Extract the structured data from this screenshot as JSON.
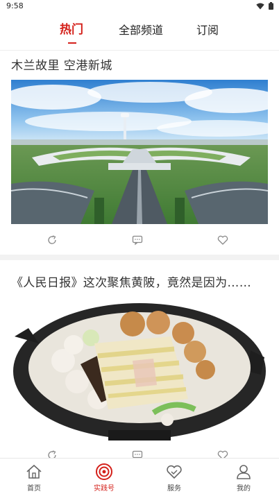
{
  "status_bar": {
    "time": "9:58"
  },
  "tabs": [
    {
      "label": "热门",
      "active": true
    },
    {
      "label": "全部频道",
      "active": false
    },
    {
      "label": "订阅",
      "active": false
    }
  ],
  "articles": [
    {
      "title": "木兰故里 空港新城",
      "image_alt": "airport aerial view"
    },
    {
      "title": "《人民日报》这次聚焦黄陂，竟然是因为……",
      "image_alt": "clay pot dish"
    }
  ],
  "bottom_nav": [
    {
      "label": "首页",
      "icon": "home-icon",
      "active": false
    },
    {
      "label": "实践号",
      "icon": "target-icon",
      "active": true
    },
    {
      "label": "服务",
      "icon": "heart-service-icon",
      "active": false
    },
    {
      "label": "我的",
      "icon": "profile-icon",
      "active": false
    }
  ],
  "colors": {
    "accent": "#d4201a",
    "text": "#333333",
    "band": "#f2f2f2"
  }
}
